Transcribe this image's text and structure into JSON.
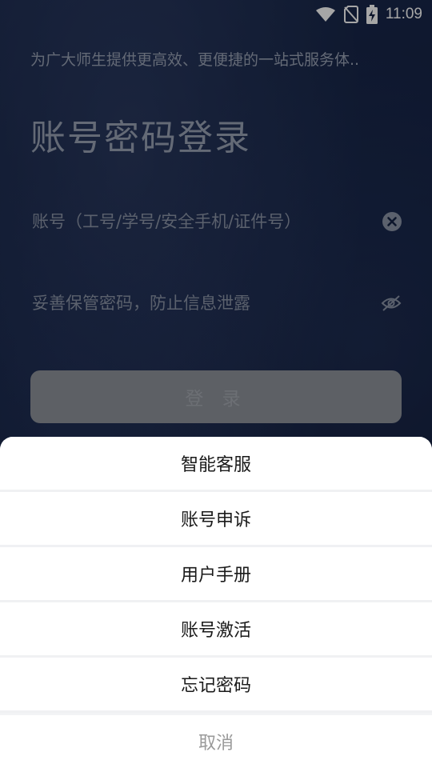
{
  "status_bar": {
    "time": "11:09",
    "icons": [
      "wifi-icon",
      "no-sim-icon",
      "battery-charging-icon"
    ]
  },
  "header": {
    "tagline": "为广大师生提供更高效、更便捷的一站式服务体..",
    "title": "账号密码登录"
  },
  "form": {
    "account_placeholder": "账号（工号/学号/安全手机/证件号）",
    "password_placeholder": "妥善保管密码，防止信息泄露",
    "login_label": "登 录"
  },
  "sheet": {
    "items": [
      {
        "label": "智能客服"
      },
      {
        "label": "账号申诉"
      },
      {
        "label": "用户手册"
      },
      {
        "label": "账号激活"
      },
      {
        "label": "忘记密码"
      }
    ],
    "cancel_label": "取消"
  },
  "colors": {
    "background": "#142244",
    "sheet": "#ffffff",
    "login_button": "#8f949c"
  }
}
